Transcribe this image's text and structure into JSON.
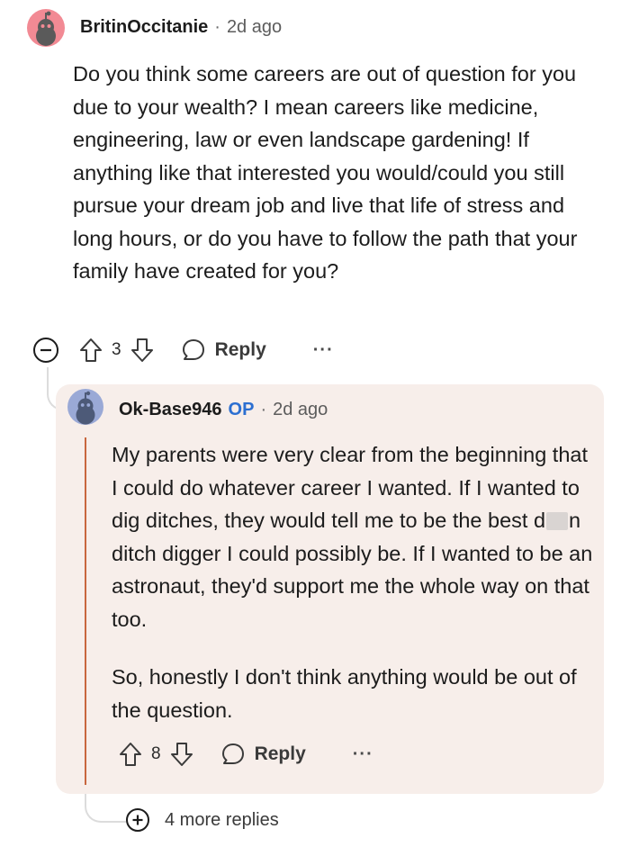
{
  "top_comment": {
    "author": "BritinOccitanie",
    "separator": "·",
    "time": "2d ago",
    "avatar_color": "#f28a94",
    "body": "Do you think some careers are out of question for you due to your wealth?  I mean careers like medicine, engineering, law or even landscape gardening! If anything like that interested you would/could you still pursue your dream job and live that life of stress and long hours, or do you have to follow the path that your family have created for you?",
    "votes": "3",
    "reply_label": "Reply",
    "more_label": "···",
    "collapse_icon": "minus-circle-icon"
  },
  "reply": {
    "author": "Ok-Base946",
    "op_badge": "OP",
    "separator": "·",
    "time": "2d ago",
    "avatar_color": "#9aa9d6",
    "card_color": "#f7eeea",
    "accent_color": "#c8673f",
    "body_part1": "My parents were very clear from the beginning that I could do whatever career I wanted. If I wanted to dig ditches, they would tell me to be the best d",
    "body_part2": "n ditch digger I could possibly be. If I wanted to be an astronaut, they'd support me the whole way on that too.",
    "body_paragraph2": "So, honestly I don't think anything would be out of the question.",
    "votes": "8",
    "reply_label": "Reply",
    "more_label": "···"
  },
  "more_replies": {
    "label": "4 more replies",
    "icon": "plus-circle-icon"
  },
  "icons": {
    "upvote": "arrow-up-icon",
    "downvote": "arrow-down-icon",
    "reply": "speech-bubble-icon",
    "avatar": "snoo-avatar-icon"
  }
}
